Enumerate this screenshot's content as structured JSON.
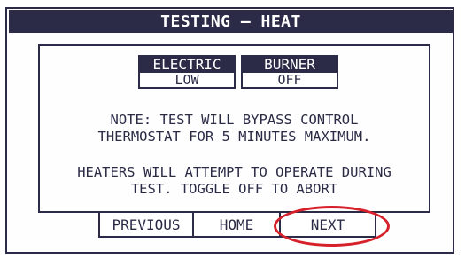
{
  "title": "TESTING – HEAT",
  "electric": {
    "label": "ELECTRIC",
    "value": "LOW"
  },
  "burner": {
    "label": "BURNER",
    "value": "OFF"
  },
  "note": {
    "line1": "NOTE: TEST WILL BYPASS CONTROL",
    "line2": "THERMOSTAT FOR 5 MINUTES MAXIMUM."
  },
  "heaters": {
    "line1": "HEATERS WILL ATTEMPT TO OPERATE DURING",
    "line2": "TEST. TOGGLE OFF TO ABORT"
  },
  "nav": {
    "previous": "PREVIOUS",
    "home": "HOME",
    "next": "NEXT"
  },
  "colors": {
    "ink": "#2b2b47",
    "highlight": "#d6202a",
    "background": "#ffffff"
  }
}
